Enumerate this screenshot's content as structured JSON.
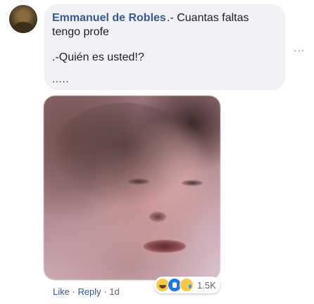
{
  "comment": {
    "author": "Emmanuel de Robles",
    "line1": ".- Cuantas faltas",
    "line2": "tengo profe",
    "line3": ".-Quién es usted!?",
    "line4": "....."
  },
  "more_menu": "...",
  "actions": {
    "like": "Like",
    "separator": "·",
    "reply": "Reply",
    "time": "1d"
  },
  "reactions": {
    "icons": [
      "haha-icon",
      "like-icon",
      "sad-icon"
    ],
    "count": "1.5K"
  },
  "colors": {
    "author": "#385898",
    "bubble": "#f0f2f5",
    "text": "#1c1e21",
    "meta": "#606770"
  }
}
